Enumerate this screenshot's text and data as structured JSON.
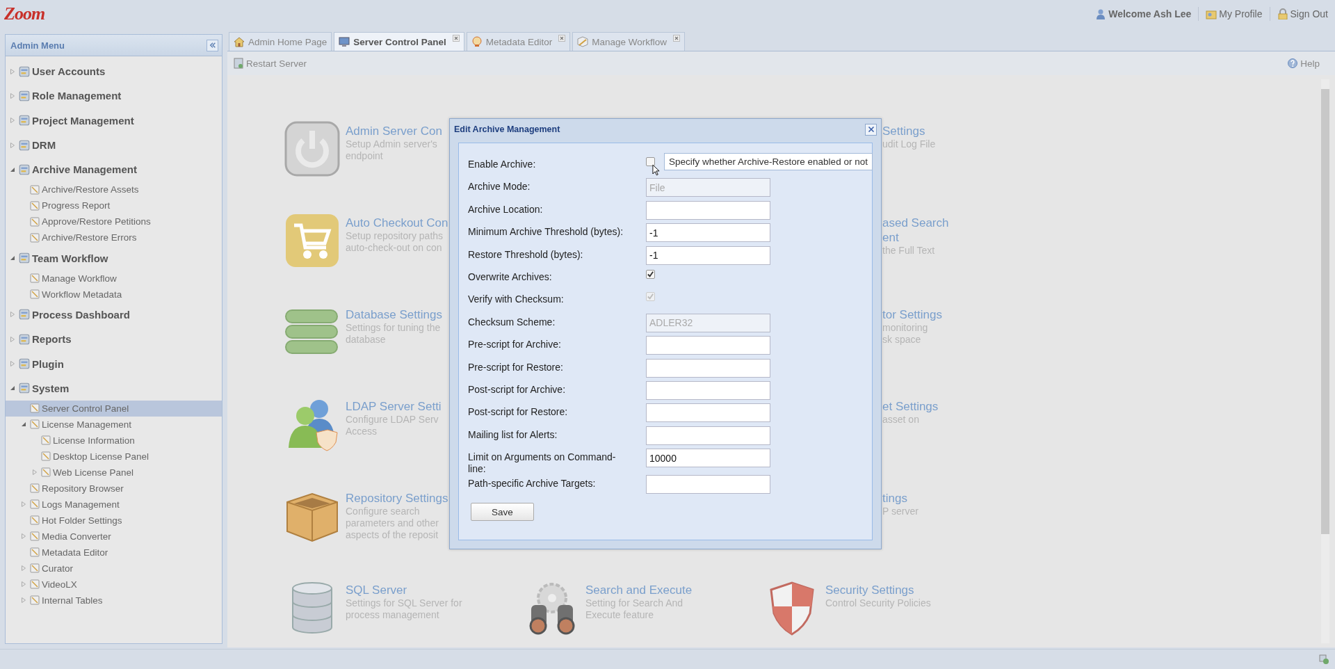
{
  "header": {
    "logo": "Zoom",
    "links": [
      {
        "kind": "welcome",
        "label": "Welcome Ash Lee"
      },
      {
        "kind": "profile",
        "label": "My Profile"
      },
      {
        "kind": "signout",
        "label": "Sign Out"
      }
    ]
  },
  "sidebar": {
    "title": "Admin Menu",
    "items": [
      {
        "label": "User Accounts",
        "expanded": false,
        "selected": false
      },
      {
        "label": "Role Management",
        "expanded": false,
        "selected": false
      },
      {
        "label": "Project Management",
        "expanded": false,
        "selected": false
      },
      {
        "label": "DRM",
        "expanded": false,
        "selected": false
      },
      {
        "label": "Archive Management",
        "expanded": true,
        "selected": false,
        "children": [
          {
            "label": "Archive/Restore Assets",
            "selected": false
          },
          {
            "label": "Progress Report",
            "selected": false
          },
          {
            "label": "Approve/Restore Petitions",
            "selected": false
          },
          {
            "label": "Archive/Restore Errors",
            "selected": false
          }
        ]
      },
      {
        "label": "Team Workflow",
        "expanded": true,
        "selected": false,
        "children": [
          {
            "label": "Manage Workflow",
            "selected": false
          },
          {
            "label": "Workflow Metadata",
            "selected": false
          }
        ]
      },
      {
        "label": "Process Dashboard",
        "expanded": false,
        "selected": false
      },
      {
        "label": "Reports",
        "expanded": false,
        "selected": false
      },
      {
        "label": "Plugin",
        "expanded": false,
        "selected": false
      },
      {
        "label": "System",
        "expanded": true,
        "selected": false,
        "children": [
          {
            "label": "Server Control Panel",
            "selected": true
          },
          {
            "label": "License Management",
            "expanded": true,
            "selected": false,
            "children": [
              {
                "label": "License Information",
                "selected": false
              },
              {
                "label": "Desktop License Panel",
                "selected": false
              },
              {
                "label": "Web License Panel",
                "expanded": false,
                "selected": false
              }
            ]
          },
          {
            "label": "Repository Browser",
            "selected": false
          },
          {
            "label": "Logs Management",
            "expanded": false,
            "selected": false
          },
          {
            "label": "Hot Folder Settings",
            "selected": false
          },
          {
            "label": "Media Converter",
            "expanded": false,
            "selected": false
          },
          {
            "label": "Metadata Editor",
            "selected": false
          },
          {
            "label": "Curator",
            "expanded": false,
            "selected": false
          },
          {
            "label": "VideoLX",
            "expanded": false,
            "selected": false
          },
          {
            "label": "Internal Tables",
            "expanded": false,
            "selected": false
          }
        ]
      }
    ]
  },
  "tabs": [
    {
      "kind": "home",
      "label": "Admin Home Page",
      "selected": false,
      "closable": false
    },
    {
      "kind": "monitor",
      "label": "Server Control Panel",
      "selected": true,
      "closable": true
    },
    {
      "kind": "editor",
      "label": "Metadata Editor",
      "selected": false,
      "closable": true
    },
    {
      "kind": "workflow",
      "label": "Manage Workflow",
      "selected": false,
      "closable": true
    }
  ],
  "toolbar": {
    "restart_button": "Restart Server",
    "help_button": "Help"
  },
  "content": {
    "rows": [
      {
        "left": {
          "kind": "power",
          "title_lines": [
            "Admin Server Con"
          ],
          "description_lines": [
            "Setup Admin server's",
            "endpoint"
          ]
        },
        "right": {
          "kind": "partial",
          "title_lines": [
            "Settings"
          ],
          "description_lines": [
            "udit Log File"
          ]
        }
      },
      {
        "left": {
          "kind": "cart",
          "title_lines": [
            "Auto Checkout Con"
          ],
          "description_lines": [
            "Setup repository paths",
            "auto-check-out on con"
          ]
        },
        "right": {
          "kind": "partial",
          "title_lines": [
            "ased Search",
            "ent"
          ],
          "description_lines": [
            "the Full Text"
          ]
        }
      },
      {
        "left": {
          "kind": "stack",
          "title_lines": [
            "Database Settings"
          ],
          "description_lines": [
            "Settings for tuning the",
            "database"
          ]
        },
        "right": {
          "kind": "partial",
          "title_lines": [
            "tor Settings"
          ],
          "description_lines": [
            "monitoring",
            "sk space"
          ]
        }
      },
      {
        "left": {
          "kind": "people",
          "title_lines": [
            "LDAP Server Setti"
          ],
          "description_lines": [
            "Configure LDAP Serv",
            "Access"
          ]
        },
        "right": {
          "kind": "partial",
          "title_lines": [
            "et Settings"
          ],
          "description_lines": [
            "asset on"
          ]
        }
      },
      {
        "left": {
          "kind": "crate",
          "title_lines": [
            "Repository Settings"
          ],
          "description_lines": [
            "Configure search",
            "parameters and other",
            "aspects of the reposit"
          ]
        },
        "right": {
          "kind": "partial",
          "title_lines": [
            "tings"
          ],
          "description_lines": [
            "P server"
          ]
        }
      },
      {
        "left": {
          "kind": "cylinder",
          "title_lines": [
            "SQL Server"
          ],
          "description_lines": [
            "Settings for SQL Server for",
            "process management"
          ]
        },
        "middle": {
          "kind": "binoculars",
          "title_lines": [
            "Search and Execute"
          ],
          "description_lines": [
            "Setting for Search And",
            "Execute feature"
          ]
        },
        "right": {
          "kind": "shield",
          "title_lines": [
            "Security Settings"
          ],
          "description_lines": [
            "Control Security Policies"
          ]
        }
      }
    ]
  },
  "dialog": {
    "title": "Edit Archive Management",
    "fields": [
      {
        "label": "Enable Archive:",
        "kind": "checkbox",
        "checked": false,
        "disabled": false,
        "tooltip": "Specify whether Archive-Restore enabled or not"
      },
      {
        "label": "Archive Mode:",
        "kind": "text",
        "value": "File",
        "disabled": true
      },
      {
        "label": "Archive Location:",
        "kind": "text",
        "disabled": false
      },
      {
        "label": "Minimum Archive Threshold (bytes):",
        "kind": "text",
        "value": "-1",
        "disabled": false
      },
      {
        "label": "Restore Threshold (bytes):",
        "kind": "text",
        "value": "-1",
        "disabled": false
      },
      {
        "label": "Overwrite Archives:",
        "kind": "checkbox",
        "checked": true,
        "disabled": false
      },
      {
        "label": "Verify with Checksum:",
        "kind": "checkbox",
        "checked": true,
        "disabled": true
      },
      {
        "label": "Checksum Scheme:",
        "kind": "text",
        "value": "ADLER32",
        "disabled": true
      },
      {
        "label": "Pre-script for Archive:",
        "kind": "text",
        "disabled": false
      },
      {
        "label": "Pre-script for Restore:",
        "kind": "text",
        "disabled": false
      },
      {
        "label": "Post-script for Archive:",
        "kind": "text",
        "disabled": false
      },
      {
        "label": "Post-script for Restore:",
        "kind": "text",
        "disabled": false
      },
      {
        "label": "Mailing list for Alerts:",
        "kind": "text",
        "disabled": false
      },
      {
        "label": "Limit on Arguments on Command-line:",
        "kind": "text",
        "value": "10000",
        "disabled": false
      },
      {
        "label": "Path-specific Archive Targets:",
        "kind": "text",
        "disabled": false
      }
    ],
    "save_button": "Save"
  }
}
